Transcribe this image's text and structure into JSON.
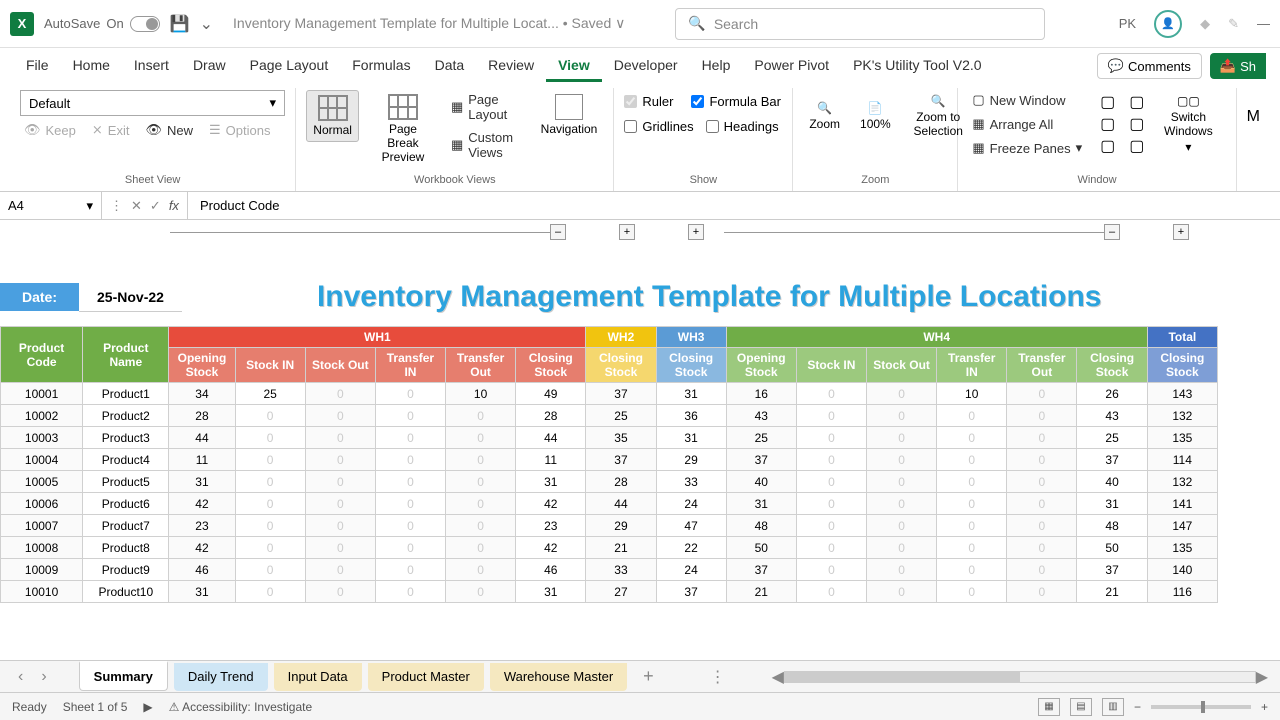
{
  "titlebar": {
    "autosave_label": "AutoSave",
    "autosave_state": "On",
    "doc_title": "Inventory Management Template for Multiple Locat... • Saved ∨",
    "search_placeholder": "Search",
    "user_initials": "PK"
  },
  "ribbon_tabs": [
    "File",
    "Home",
    "Insert",
    "Draw",
    "Page Layout",
    "Formulas",
    "Data",
    "Review",
    "View",
    "Developer",
    "Help",
    "Power Pivot",
    "PK's Utility Tool V2.0"
  ],
  "ribbon_active_tab": "View",
  "comments_btn": "Comments",
  "share_btn": "Sh",
  "ribbon": {
    "sheet_view": {
      "default_dropdown": "Default",
      "keep": "Keep",
      "exit": "Exit",
      "new": "New",
      "options": "Options",
      "group_label": "Sheet View"
    },
    "workbook_views": {
      "normal": "Normal",
      "page_break": "Page Break Preview",
      "page_layout": "Page Layout",
      "custom_views": "Custom Views",
      "navigation": "Navigation",
      "group_label": "Workbook Views"
    },
    "show": {
      "ruler": "Ruler",
      "gridlines": "Gridlines",
      "formula_bar": "Formula Bar",
      "headings": "Headings",
      "group_label": "Show"
    },
    "zoom": {
      "zoom": "Zoom",
      "hundred": "100%",
      "zoom_sel": "Zoom to Selection",
      "group_label": "Zoom"
    },
    "window": {
      "new_window": "New Window",
      "arrange_all": "Arrange All",
      "freeze_panes": "Freeze Panes",
      "switch_windows": "Switch Windows",
      "group_label": "Window"
    }
  },
  "formula_bar": {
    "cell_ref": "A4",
    "formula_value": "Product Code"
  },
  "sheet_header": {
    "date_label": "Date:",
    "date_value": "25-Nov-22",
    "title": "Inventory Management Template for Multiple Locations"
  },
  "table": {
    "group_headers": {
      "wh1": "WH1",
      "wh2": "WH2",
      "wh3": "WH3",
      "wh4": "WH4",
      "total": "Total"
    },
    "prod_code_hdr": "Product Code",
    "prod_name_hdr": "Product Name",
    "sub_headers": {
      "opening": "Opening Stock",
      "stock_in": "Stock IN",
      "stock_out": "Stock Out",
      "transfer_in": "Transfer IN",
      "transfer_out": "Transfer Out",
      "closing": "Closing Stock"
    },
    "rows": [
      {
        "code": "10001",
        "name": "Product1",
        "wh1": [
          34,
          25,
          0,
          0,
          10,
          49
        ],
        "wh2": 37,
        "wh3": 31,
        "wh4": [
          16,
          0,
          0,
          10,
          0,
          26
        ],
        "total": 143
      },
      {
        "code": "10002",
        "name": "Product2",
        "wh1": [
          28,
          0,
          0,
          0,
          0,
          28
        ],
        "wh2": 25,
        "wh3": 36,
        "wh4": [
          43,
          0,
          0,
          0,
          0,
          43
        ],
        "total": 132
      },
      {
        "code": "10003",
        "name": "Product3",
        "wh1": [
          44,
          0,
          0,
          0,
          0,
          44
        ],
        "wh2": 35,
        "wh3": 31,
        "wh4": [
          25,
          0,
          0,
          0,
          0,
          25
        ],
        "total": 135
      },
      {
        "code": "10004",
        "name": "Product4",
        "wh1": [
          11,
          0,
          0,
          0,
          0,
          11
        ],
        "wh2": 37,
        "wh3": 29,
        "wh4": [
          37,
          0,
          0,
          0,
          0,
          37
        ],
        "total": 114
      },
      {
        "code": "10005",
        "name": "Product5",
        "wh1": [
          31,
          0,
          0,
          0,
          0,
          31
        ],
        "wh2": 28,
        "wh3": 33,
        "wh4": [
          40,
          0,
          0,
          0,
          0,
          40
        ],
        "total": 132
      },
      {
        "code": "10006",
        "name": "Product6",
        "wh1": [
          42,
          0,
          0,
          0,
          0,
          42
        ],
        "wh2": 44,
        "wh3": 24,
        "wh4": [
          31,
          0,
          0,
          0,
          0,
          31
        ],
        "total": 141
      },
      {
        "code": "10007",
        "name": "Product7",
        "wh1": [
          23,
          0,
          0,
          0,
          0,
          23
        ],
        "wh2": 29,
        "wh3": 47,
        "wh4": [
          48,
          0,
          0,
          0,
          0,
          48
        ],
        "total": 147
      },
      {
        "code": "10008",
        "name": "Product8",
        "wh1": [
          42,
          0,
          0,
          0,
          0,
          42
        ],
        "wh2": 21,
        "wh3": 22,
        "wh4": [
          50,
          0,
          0,
          0,
          0,
          50
        ],
        "total": 135
      },
      {
        "code": "10009",
        "name": "Product9",
        "wh1": [
          46,
          0,
          0,
          0,
          0,
          46
        ],
        "wh2": 33,
        "wh3": 24,
        "wh4": [
          37,
          0,
          0,
          0,
          0,
          37
        ],
        "total": 140
      },
      {
        "code": "10010",
        "name": "Product10",
        "wh1": [
          31,
          0,
          0,
          0,
          0,
          31
        ],
        "wh2": 27,
        "wh3": 37,
        "wh4": [
          21,
          0,
          0,
          0,
          0,
          21
        ],
        "total": 116
      }
    ]
  },
  "sheet_tabs": {
    "active": "Summary",
    "tabs": [
      "Summary",
      "Daily Trend",
      "Input Data",
      "Product Master",
      "Warehouse Master"
    ]
  },
  "statusbar": {
    "ready": "Ready",
    "sheet_info": "Sheet 1 of 5",
    "accessibility": "Accessibility: Investigate"
  }
}
